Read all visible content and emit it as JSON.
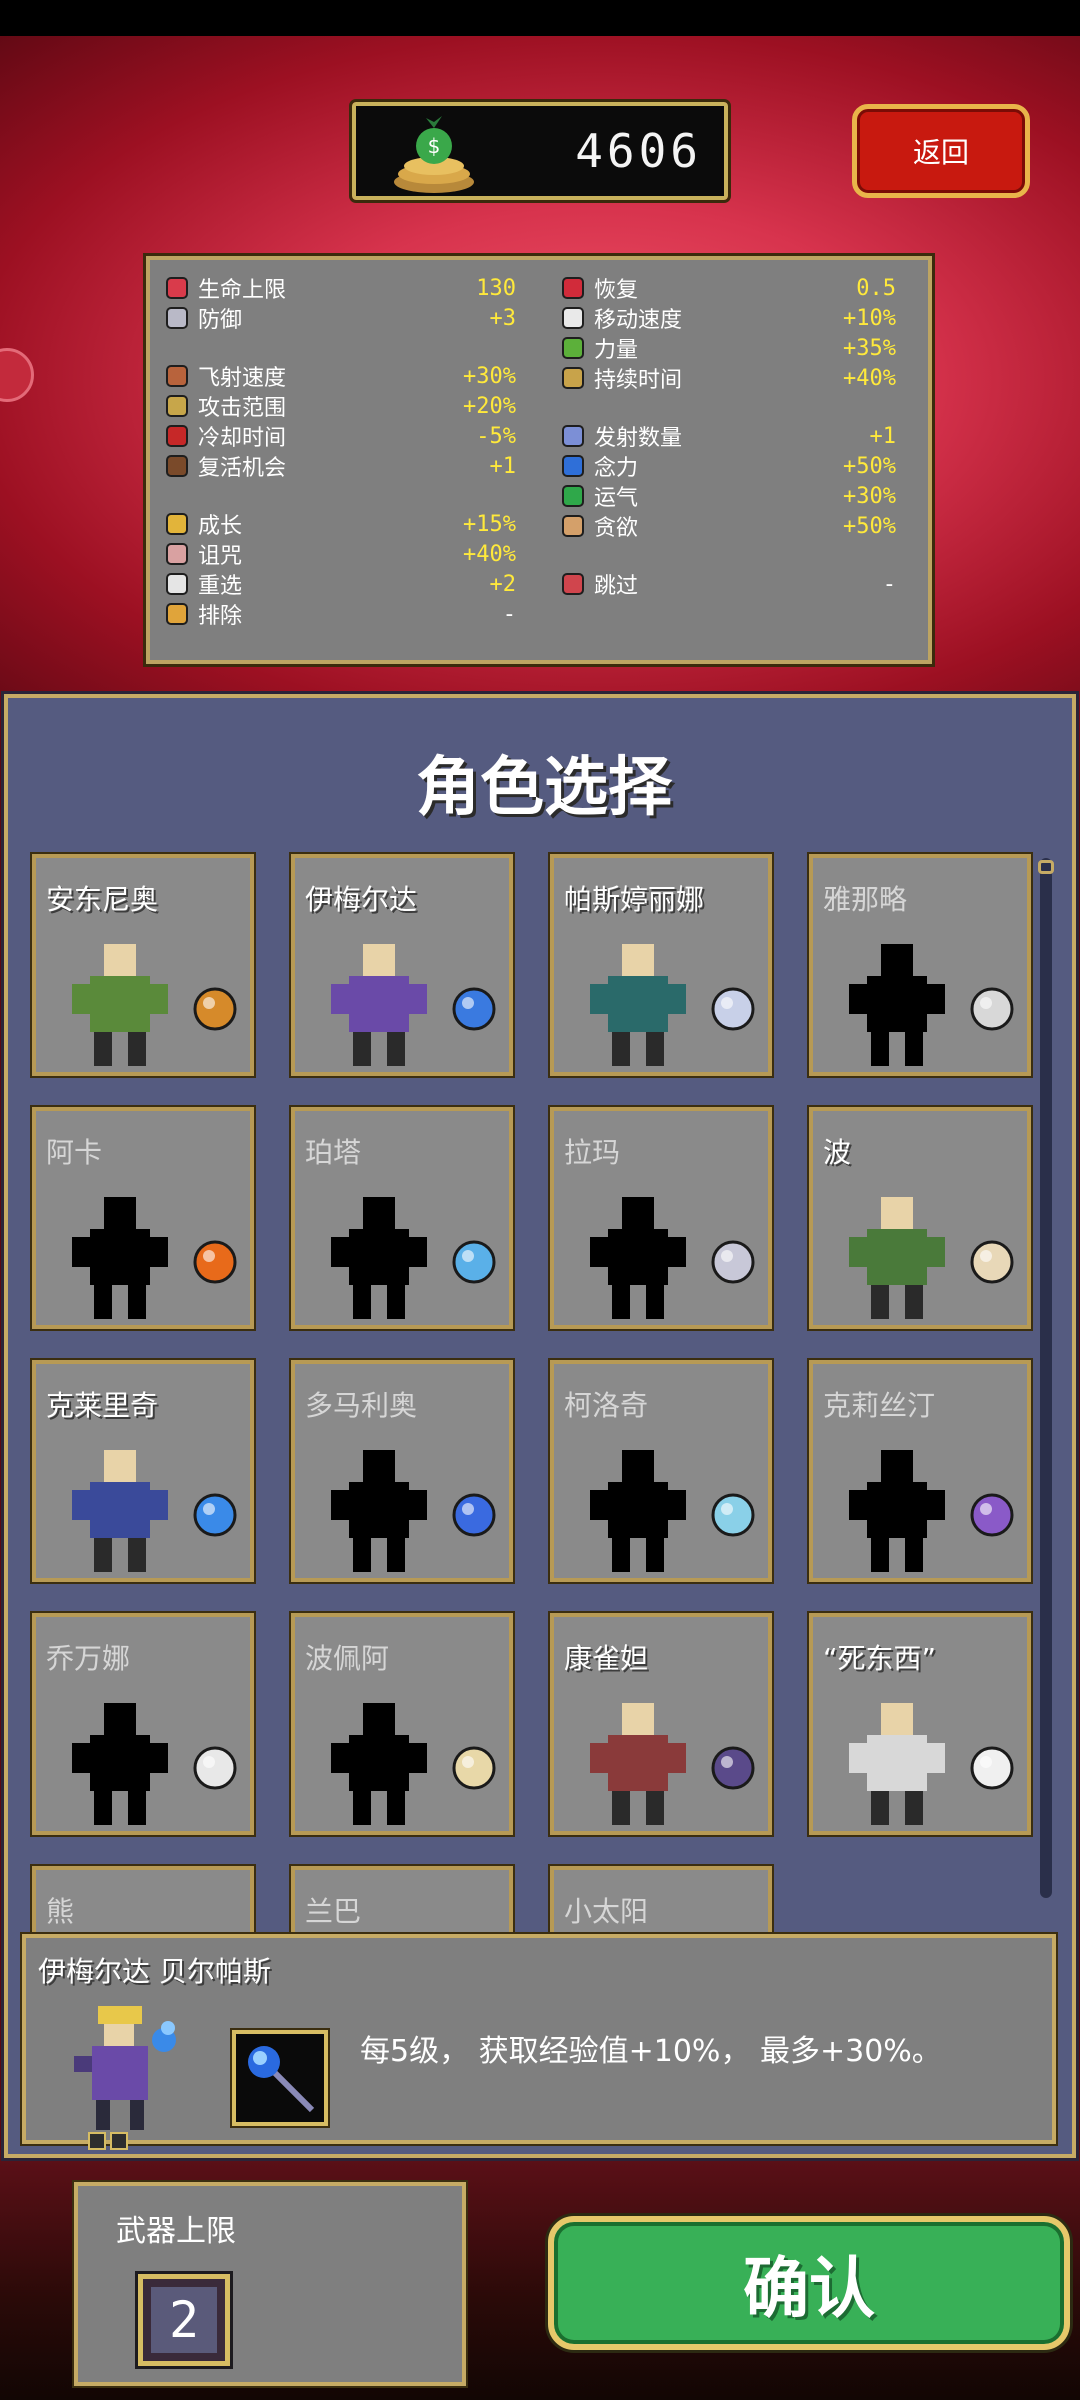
{
  "header": {
    "coins": "4606",
    "back_label": "返回"
  },
  "stats": {
    "left": [
      {
        "name": "生命上限",
        "value": "130",
        "icon": "hearts-icon",
        "color": "#d93b4b"
      },
      {
        "name": "防御",
        "value": "+3",
        "icon": "armor-icon",
        "color": "#b9b9c7"
      },
      {
        "name": "飞射速度",
        "value": "+30%",
        "icon": "speed-scroll-icon",
        "color": "#b8633c"
      },
      {
        "name": "攻击范围",
        "value": "+20%",
        "icon": "candelabra-icon",
        "color": "#c7a64a"
      },
      {
        "name": "冷却时间",
        "value": "-5%",
        "icon": "hourglass-icon",
        "color": "#c62828"
      },
      {
        "name": "复活机会",
        "value": "+1",
        "icon": "tiragisu-icon",
        "color": "#7a4a2a"
      },
      {
        "name": "成长",
        "value": "+15%",
        "icon": "crown-icon",
        "color": "#e2b43a"
      },
      {
        "name": "诅咒",
        "value": "+40%",
        "icon": "skull-icon",
        "color": "#d9a1a1"
      },
      {
        "name": "重选",
        "value": "+2",
        "icon": "dice-icon",
        "color": "#e5e5e5"
      },
      {
        "name": "排除",
        "value": "-",
        "icon": "banish-icon",
        "color": "#e0a43a"
      }
    ],
    "right": [
      {
        "name": "恢复",
        "value": "0.5",
        "icon": "heart-icon",
        "color": "#d12b3a"
      },
      {
        "name": "移动速度",
        "value": "+10%",
        "icon": "wings-icon",
        "color": "#e9e9e9"
      },
      {
        "name": "力量",
        "value": "+35%",
        "icon": "spinach-icon",
        "color": "#5cb03a"
      },
      {
        "name": "持续时间",
        "value": "+40%",
        "icon": "spellbinder-icon",
        "color": "#c8a34a"
      },
      {
        "name": "发射数量",
        "value": "+1",
        "icon": "duplicator-icon",
        "color": "#7c8fd6"
      },
      {
        "name": "念力",
        "value": "+50%",
        "icon": "attractorb-icon",
        "color": "#2f6fd8"
      },
      {
        "name": "运气",
        "value": "+30%",
        "icon": "clover-icon",
        "color": "#2fa84a"
      },
      {
        "name": "贪欲",
        "value": "+50%",
        "icon": "stone-mask-icon",
        "color": "#d4a06a"
      },
      {
        "name": "跳过",
        "value": "-",
        "icon": "skip-icon",
        "color": "#d0454d"
      }
    ]
  },
  "select": {
    "title": "角色选择",
    "characters": [
      {
        "name": "安东尼奥",
        "locked": false,
        "body": "#5a8a3a",
        "weapon": "whip-icon",
        "wcolor": "#d68a2a"
      },
      {
        "name": "伊梅尔达",
        "locked": false,
        "body": "#6a4aa8",
        "weapon": "magic-wand-icon",
        "wcolor": "#3a7ae0"
      },
      {
        "name": "帕斯婷丽娜",
        "locked": false,
        "body": "#2a6a6a",
        "weapon": "runetracer-icon",
        "wcolor": "#c8d0e8"
      },
      {
        "name": "雅那略",
        "locked": true,
        "body": "#000000",
        "weapon": "knife-icon",
        "wcolor": "#d8d8d8"
      },
      {
        "name": "阿卡",
        "locked": true,
        "body": "#000000",
        "weapon": "fire-wand-icon",
        "wcolor": "#e86a1a"
      },
      {
        "name": "珀塔",
        "locked": true,
        "body": "#000000",
        "weapon": "lightning-ring-icon",
        "wcolor": "#5ab0e8"
      },
      {
        "name": "拉玛",
        "locked": true,
        "body": "#000000",
        "weapon": "axe-icon",
        "wcolor": "#c8c8d8"
      },
      {
        "name": "波",
        "locked": false,
        "body": "#4a7a3a",
        "weapon": "garlic-icon",
        "wcolor": "#e8d8b8"
      },
      {
        "name": "克莱里奇",
        "locked": false,
        "body": "#3a4a9a",
        "weapon": "holy-water-icon",
        "wcolor": "#3a8ae8"
      },
      {
        "name": "多马利奥",
        "locked": true,
        "body": "#000000",
        "weapon": "king-bible-icon",
        "wcolor": "#3a6ae0"
      },
      {
        "name": "柯洛奇",
        "locked": true,
        "body": "#000000",
        "weapon": "cross-icon",
        "wcolor": "#8ad0e8"
      },
      {
        "name": "克莉丝汀",
        "locked": true,
        "body": "#000000",
        "weapon": "pentagram-icon",
        "wcolor": "#8a5ac8"
      },
      {
        "name": "乔万娜",
        "locked": true,
        "body": "#000000",
        "weapon": "peachone-icon",
        "wcolor": "#e8e8e8"
      },
      {
        "name": "波佩阿",
        "locked": true,
        "body": "#000000",
        "weapon": "song-of-mana-icon",
        "wcolor": "#e8d8a8"
      },
      {
        "name": "康雀妲",
        "locked": false,
        "body": "#8a3a3a",
        "weapon": "vento-sacro-icon",
        "wcolor": "#5a4a8a"
      },
      {
        "name": "“死东西”",
        "locked": false,
        "body": "#d8d8d8",
        "weapon": "bone-icon",
        "wcolor": "#f0f0f0"
      },
      {
        "name": "熊",
        "locked": true,
        "body": "#000000",
        "weapon": "none",
        "wcolor": "#000000"
      },
      {
        "name": "兰巴",
        "locked": true,
        "body": "#000000",
        "weapon": "none",
        "wcolor": "#000000"
      },
      {
        "name": "小太阳",
        "locked": true,
        "body": "#000000",
        "weapon": "none",
        "wcolor": "#000000"
      }
    ]
  },
  "detail": {
    "full_name": "伊梅尔达 贝尔帕斯",
    "description": "每5级， 获取经验值+10%， 最多+30%。",
    "weapon": "magic-wand-icon"
  },
  "footer": {
    "weapon_limit_label": "武器上限",
    "weapon_limit_value": "2",
    "confirm_label": "确认"
  }
}
